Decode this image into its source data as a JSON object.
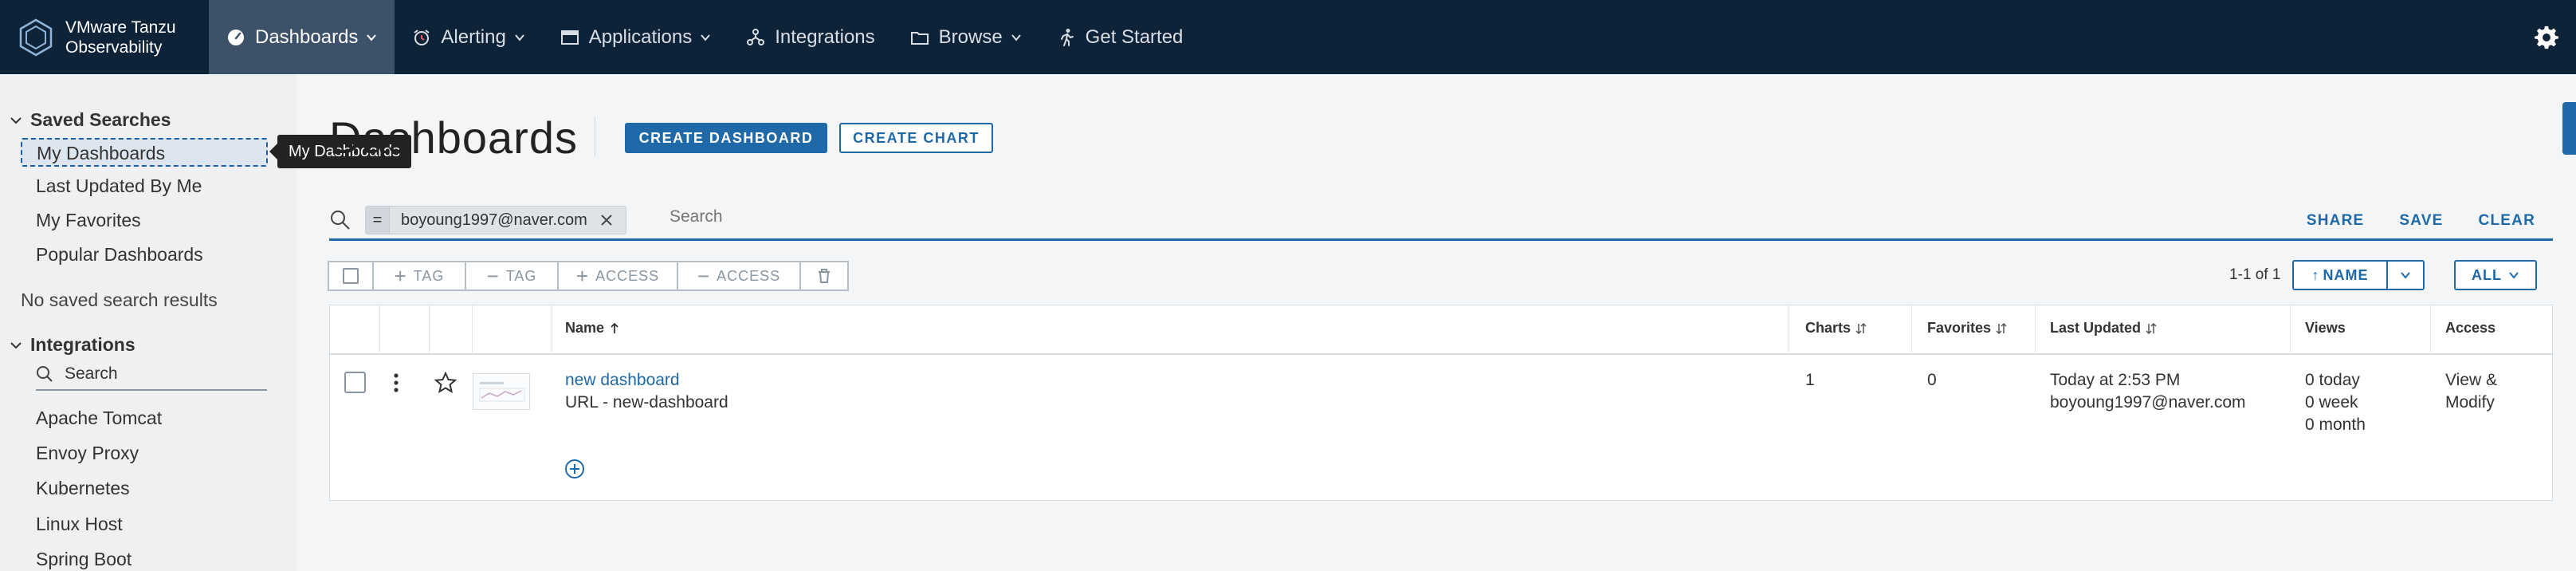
{
  "brand": {
    "line1": "VMware Tanzu",
    "line2": "Observability"
  },
  "nav": [
    {
      "label": "Dashboards",
      "icon": "gauge-icon",
      "dropdown": true,
      "active": true
    },
    {
      "label": "Alerting",
      "icon": "alarm-clock-icon",
      "dropdown": true
    },
    {
      "label": "Applications",
      "icon": "window-icon",
      "dropdown": true
    },
    {
      "label": "Integrations",
      "icon": "integrations-icon",
      "dropdown": false
    },
    {
      "label": "Browse",
      "icon": "folder-icon",
      "dropdown": true
    },
    {
      "label": "Get Started",
      "icon": "runner-icon",
      "dropdown": false
    }
  ],
  "sidebar": {
    "saved_heading": "Saved Searches",
    "saved_items": [
      "My Dashboards",
      "Last Updated By Me",
      "My Favorites",
      "Popular Dashboards"
    ],
    "no_results": "No saved search results",
    "integrations_heading": "Integrations",
    "search_placeholder": "Search",
    "integration_items": [
      "Apache Tomcat",
      "Envoy Proxy",
      "Kubernetes",
      "Linux Host",
      "Spring Boot"
    ]
  },
  "tooltip": "My Dashboards",
  "main": {
    "title": "Dashboards",
    "create_dashboard": "CREATE DASHBOARD",
    "create_chart": "CREATE CHART",
    "filter_operator": "=",
    "filter_value": "boyoung1997@naver.com",
    "search_placeholder": "Search",
    "share": "SHARE",
    "save": "SAVE",
    "clear": "CLEAR",
    "toolbar": {
      "add_tag": "TAG",
      "remove_tag": "TAG",
      "add_access": "ACCESS",
      "remove_access": "ACCESS"
    },
    "paging": "1-1 of 1",
    "sort_label": "NAME",
    "filter_all": "ALL"
  },
  "table": {
    "headers": {
      "name": "Name",
      "charts": "Charts",
      "favorites": "Favorites",
      "last_updated": "Last Updated",
      "views": "Views",
      "access": "Access"
    },
    "rows": [
      {
        "name": "new dashboard",
        "url": "URL - new-dashboard",
        "charts": "1",
        "favorites": "0",
        "updated_time": "Today at 2:53 PM",
        "updated_by": "boyoung1997@naver.com",
        "views_today": "0 today",
        "views_week": "0 week",
        "views_month": "0 month",
        "access_line1": "View &",
        "access_line2": "Modify"
      }
    ]
  },
  "colors": {
    "nav_bg": "#0f2338",
    "nav_active": "#3d5169",
    "accent": "#1f69a8"
  }
}
